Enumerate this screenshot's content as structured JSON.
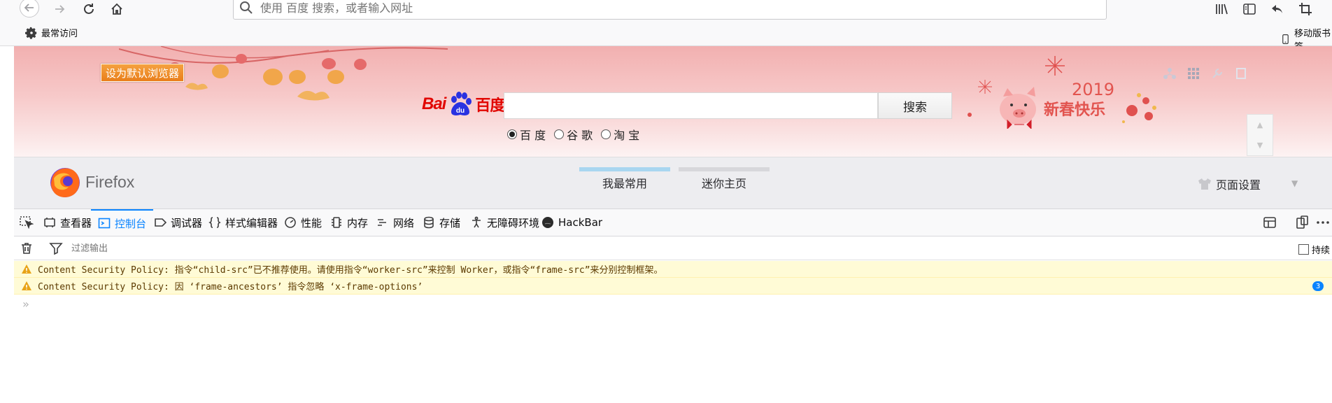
{
  "toolbar": {
    "url_placeholder": "使用 百度 搜索，或者输入网址"
  },
  "bookmarks": {
    "most_visited": "最常访问",
    "mobile": "移动版书签"
  },
  "baidu": {
    "set_default_label": "设为默认浏览器",
    "logo_latin": "Bai",
    "logo_du": "du",
    "logo_cn": "百度",
    "search_button": "搜索",
    "search_value": "",
    "radio_options": [
      "百 度",
      "谷 歌",
      "淘 宝"
    ],
    "radio_selected": "百 度",
    "newyear_year": "2019",
    "newyear_text": "新春快乐"
  },
  "firefox_strip": {
    "brand": "Firefox",
    "tabs": [
      {
        "label": "我最常用",
        "bar_color": "#a8d6f0"
      },
      {
        "label": "迷你主页",
        "bar_color": "#d7d7db"
      }
    ],
    "page_settings": "页面设置"
  },
  "devtools": {
    "tabs": [
      "查看器",
      "控制台",
      "调试器",
      "样式编辑器",
      "性能",
      "内存",
      "网络",
      "存储",
      "无障碍环境",
      "HackBar"
    ],
    "active_tab": "控制台",
    "filter_placeholder": "过滤输出",
    "persist_label": "持续",
    "messages": [
      {
        "text": "Content Security Policy: 指令“child-src”已不推荐使用。请使用指令“worker-src”来控制 Worker，或指令“frame-src”来分别控制框架。",
        "level": "warning"
      },
      {
        "text": "Content Security Policy: 因 ‘frame-ancestors’ 指令忽略 ‘x-frame-options’",
        "level": "warning",
        "count": "3"
      }
    ],
    "prompt": "»"
  },
  "colors": {
    "accent": "#0a84ff",
    "warning_bg": "#fffbd6",
    "baidu_red": "#e10601",
    "banner_pink": "#f2b0b0"
  }
}
